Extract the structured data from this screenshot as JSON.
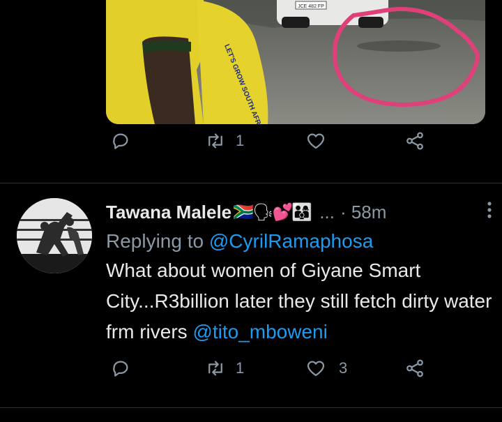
{
  "icons": {
    "reply": "speech-bubble-icon",
    "retweet": "retweet-arrows-icon",
    "like": "heart-icon",
    "share": "share-icon"
  },
  "prev_tweet": {
    "media_car_plate": "JCE 482 FP",
    "media_shirt_text": "LET'S GROW SOUTH AFRICA TOGETHER",
    "retweets": "1",
    "likes": ""
  },
  "tweet": {
    "name": "Tawana Malele",
    "name_emojis": "🇿🇦🗣💕👨‍👩‍👦",
    "ellipsis": "...",
    "time": "· 58m",
    "reply_prefix": "Replying to",
    "reply_handle": "@CyrilRamaphosa",
    "text": "What about women of Giyane Smart City...R3billion later they still fetch dirty water frm rivers",
    "mention": "@tito_mboweni",
    "retweets": "1",
    "likes": "3"
  },
  "colors": {
    "background": "#000000",
    "text": "#e7e9ea",
    "muted": "#8b98a5",
    "link": "#1d9bf0",
    "divider": "#2f3336",
    "annotation": "#e0407a"
  }
}
